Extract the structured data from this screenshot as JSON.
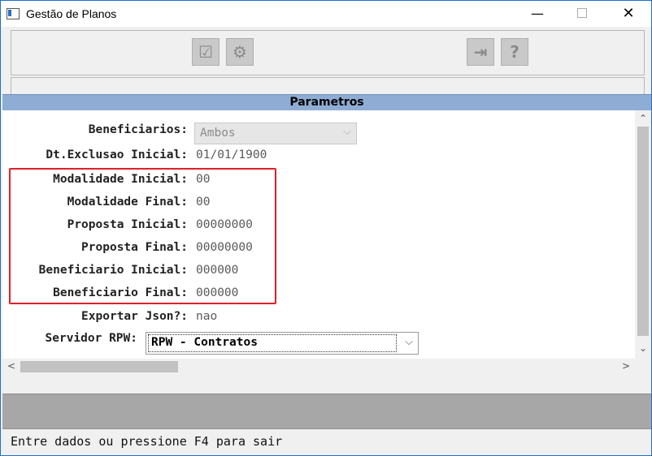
{
  "window": {
    "title": "Gestão de Planos",
    "minimize": "—",
    "close": "✕"
  },
  "toolbar": {
    "buttons": [
      {
        "icon": "checklist-icon",
        "glyph": "☑"
      },
      {
        "icon": "grid-gear-icon",
        "glyph": "⚙"
      },
      {
        "icon": "exit-door-icon",
        "glyph": "⇥"
      },
      {
        "icon": "help-icon",
        "glyph": "?"
      }
    ]
  },
  "panel": {
    "title": "Parametros",
    "fields": {
      "beneficiarios": {
        "label": "Beneficiarios:",
        "value": "Ambos"
      },
      "dt_exclusao": {
        "label": "Dt.Exclusao Inicial:",
        "value": "01/01/1900"
      },
      "modalidade_ini": {
        "label": "Modalidade Inicial:",
        "value": "00"
      },
      "modalidade_fim": {
        "label": "Modalidade Final:",
        "value": "00"
      },
      "proposta_ini": {
        "label": "Proposta Inicial:",
        "value": "00000000"
      },
      "proposta_fim": {
        "label": "Proposta Final:",
        "value": "00000000"
      },
      "benef_ini": {
        "label": "Beneficiario Inicial:",
        "value": "000000"
      },
      "benef_fim": {
        "label": "Beneficiario Final:",
        "value": "000000"
      },
      "exportar_json": {
        "label": "Exportar Json?:",
        "value": "nao"
      },
      "servidor_rpw": {
        "label": "Servidor RPW:",
        "value": "RPW - Contratos"
      }
    }
  },
  "status": {
    "message": "Entre dados ou pressione F4 para sair"
  },
  "colors": {
    "panel_header": "#8fadd4",
    "highlight": "#e0202a",
    "status_bar_grey": "#a7a7a7"
  }
}
